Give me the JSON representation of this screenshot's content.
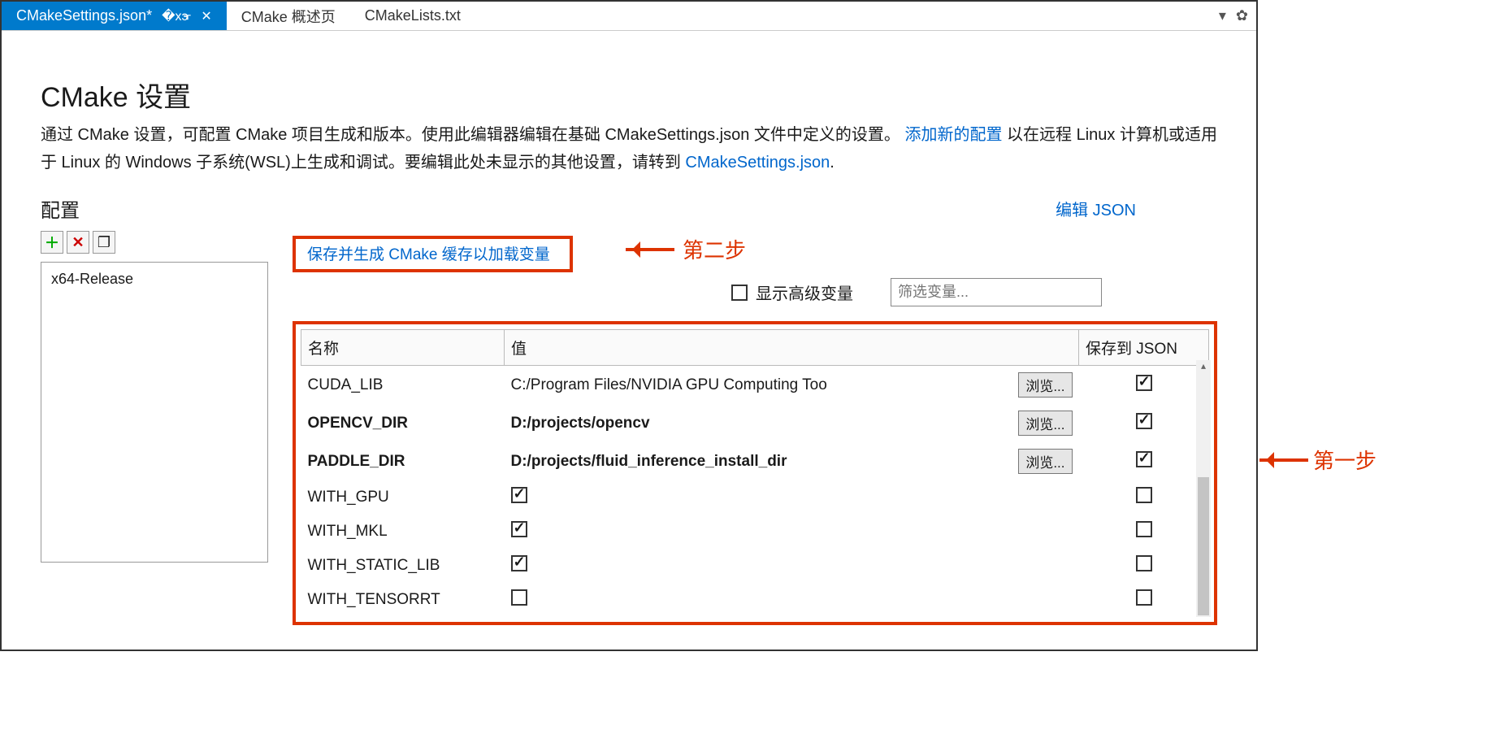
{
  "tabs": {
    "active": {
      "label": "CMakeSettings.json*",
      "pin": "⊕",
      "close": "✕"
    },
    "others": [
      "CMake 概述页",
      "CMakeLists.txt"
    ]
  },
  "title": "CMake 设置",
  "desc": {
    "part1": "通过 CMake 设置，可配置 CMake 项目生成和版本。使用此编辑器编辑在基础 CMakeSettings.json 文件中定义的设置。 ",
    "link1": "添加新的配置",
    "part2": " 以在远程 Linux 计算机或适用于 Linux 的 Windows 子系统(WSL)上生成和调试。要编辑此处未显示的其他设置，请转到 ",
    "link2": "CMakeSettings.json",
    "part3": "."
  },
  "config_label": "配置",
  "edit_json": "编辑 JSON",
  "toolbar": {
    "add": "＋",
    "del": "✕",
    "copy": "❐"
  },
  "config_items": [
    "x64-Release"
  ],
  "save_cache_link": "保存并生成 CMake 缓存以加载变量",
  "show_advanced_label": "显示高级变量",
  "filter_placeholder": "筛选变量...",
  "columns": {
    "name": "名称",
    "value": "值",
    "save": "保存到 JSON"
  },
  "browse_label": "浏览...",
  "variables": [
    {
      "name": "CUDA_LIB",
      "bold": false,
      "valueType": "path",
      "value": "C:/Program Files/NVIDIA GPU Computing Too",
      "saveJson": true
    },
    {
      "name": "OPENCV_DIR",
      "bold": true,
      "valueType": "path",
      "value": "D:/projects/opencv",
      "saveJson": true
    },
    {
      "name": "PADDLE_DIR",
      "bold": true,
      "valueType": "path",
      "value": "D:/projects/fluid_inference_install_dir",
      "saveJson": true
    },
    {
      "name": "WITH_GPU",
      "bold": false,
      "valueType": "bool",
      "checked": true,
      "saveJson": false
    },
    {
      "name": "WITH_MKL",
      "bold": false,
      "valueType": "bool",
      "checked": true,
      "saveJson": false
    },
    {
      "name": "WITH_STATIC_LIB",
      "bold": false,
      "valueType": "bool",
      "checked": true,
      "saveJson": false
    },
    {
      "name": "WITH_TENSORRT",
      "bold": false,
      "valueType": "bool",
      "checked": false,
      "saveJson": false
    }
  ],
  "annotations": {
    "step1": "第一步",
    "step2": "第二步"
  }
}
